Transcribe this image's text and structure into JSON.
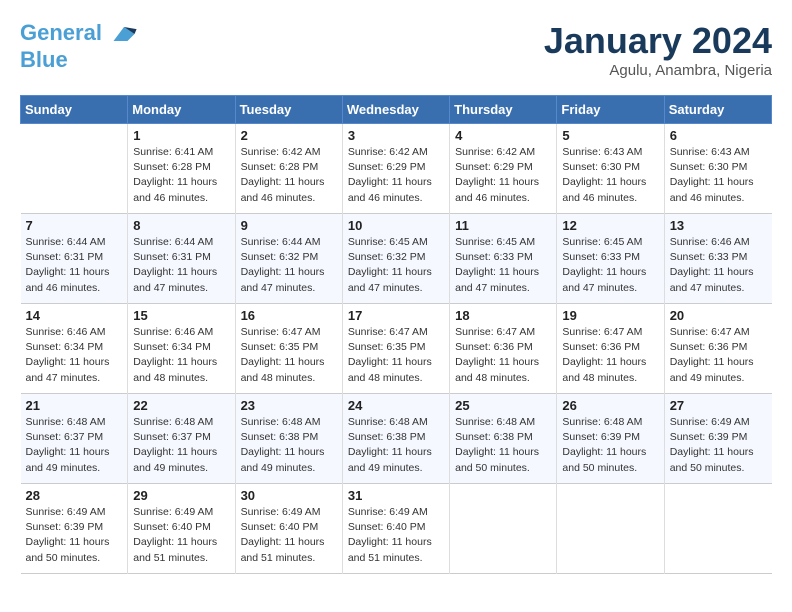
{
  "header": {
    "logo_line1": "General",
    "logo_line2": "Blue",
    "month": "January 2024",
    "location": "Agulu, Anambra, Nigeria"
  },
  "weekdays": [
    "Sunday",
    "Monday",
    "Tuesday",
    "Wednesday",
    "Thursday",
    "Friday",
    "Saturday"
  ],
  "weeks": [
    [
      {
        "day": "",
        "info": ""
      },
      {
        "day": "1",
        "info": "Sunrise: 6:41 AM\nSunset: 6:28 PM\nDaylight: 11 hours\nand 46 minutes."
      },
      {
        "day": "2",
        "info": "Sunrise: 6:42 AM\nSunset: 6:28 PM\nDaylight: 11 hours\nand 46 minutes."
      },
      {
        "day": "3",
        "info": "Sunrise: 6:42 AM\nSunset: 6:29 PM\nDaylight: 11 hours\nand 46 minutes."
      },
      {
        "day": "4",
        "info": "Sunrise: 6:42 AM\nSunset: 6:29 PM\nDaylight: 11 hours\nand 46 minutes."
      },
      {
        "day": "5",
        "info": "Sunrise: 6:43 AM\nSunset: 6:30 PM\nDaylight: 11 hours\nand 46 minutes."
      },
      {
        "day": "6",
        "info": "Sunrise: 6:43 AM\nSunset: 6:30 PM\nDaylight: 11 hours\nand 46 minutes."
      }
    ],
    [
      {
        "day": "7",
        "info": "Sunrise: 6:44 AM\nSunset: 6:31 PM\nDaylight: 11 hours\nand 46 minutes."
      },
      {
        "day": "8",
        "info": "Sunrise: 6:44 AM\nSunset: 6:31 PM\nDaylight: 11 hours\nand 47 minutes."
      },
      {
        "day": "9",
        "info": "Sunrise: 6:44 AM\nSunset: 6:32 PM\nDaylight: 11 hours\nand 47 minutes."
      },
      {
        "day": "10",
        "info": "Sunrise: 6:45 AM\nSunset: 6:32 PM\nDaylight: 11 hours\nand 47 minutes."
      },
      {
        "day": "11",
        "info": "Sunrise: 6:45 AM\nSunset: 6:33 PM\nDaylight: 11 hours\nand 47 minutes."
      },
      {
        "day": "12",
        "info": "Sunrise: 6:45 AM\nSunset: 6:33 PM\nDaylight: 11 hours\nand 47 minutes."
      },
      {
        "day": "13",
        "info": "Sunrise: 6:46 AM\nSunset: 6:33 PM\nDaylight: 11 hours\nand 47 minutes."
      }
    ],
    [
      {
        "day": "14",
        "info": "Sunrise: 6:46 AM\nSunset: 6:34 PM\nDaylight: 11 hours\nand 47 minutes."
      },
      {
        "day": "15",
        "info": "Sunrise: 6:46 AM\nSunset: 6:34 PM\nDaylight: 11 hours\nand 48 minutes."
      },
      {
        "day": "16",
        "info": "Sunrise: 6:47 AM\nSunset: 6:35 PM\nDaylight: 11 hours\nand 48 minutes."
      },
      {
        "day": "17",
        "info": "Sunrise: 6:47 AM\nSunset: 6:35 PM\nDaylight: 11 hours\nand 48 minutes."
      },
      {
        "day": "18",
        "info": "Sunrise: 6:47 AM\nSunset: 6:36 PM\nDaylight: 11 hours\nand 48 minutes."
      },
      {
        "day": "19",
        "info": "Sunrise: 6:47 AM\nSunset: 6:36 PM\nDaylight: 11 hours\nand 48 minutes."
      },
      {
        "day": "20",
        "info": "Sunrise: 6:47 AM\nSunset: 6:36 PM\nDaylight: 11 hours\nand 49 minutes."
      }
    ],
    [
      {
        "day": "21",
        "info": "Sunrise: 6:48 AM\nSunset: 6:37 PM\nDaylight: 11 hours\nand 49 minutes."
      },
      {
        "day": "22",
        "info": "Sunrise: 6:48 AM\nSunset: 6:37 PM\nDaylight: 11 hours\nand 49 minutes."
      },
      {
        "day": "23",
        "info": "Sunrise: 6:48 AM\nSunset: 6:38 PM\nDaylight: 11 hours\nand 49 minutes."
      },
      {
        "day": "24",
        "info": "Sunrise: 6:48 AM\nSunset: 6:38 PM\nDaylight: 11 hours\nand 49 minutes."
      },
      {
        "day": "25",
        "info": "Sunrise: 6:48 AM\nSunset: 6:38 PM\nDaylight: 11 hours\nand 50 minutes."
      },
      {
        "day": "26",
        "info": "Sunrise: 6:48 AM\nSunset: 6:39 PM\nDaylight: 11 hours\nand 50 minutes."
      },
      {
        "day": "27",
        "info": "Sunrise: 6:49 AM\nSunset: 6:39 PM\nDaylight: 11 hours\nand 50 minutes."
      }
    ],
    [
      {
        "day": "28",
        "info": "Sunrise: 6:49 AM\nSunset: 6:39 PM\nDaylight: 11 hours\nand 50 minutes."
      },
      {
        "day": "29",
        "info": "Sunrise: 6:49 AM\nSunset: 6:40 PM\nDaylight: 11 hours\nand 51 minutes."
      },
      {
        "day": "30",
        "info": "Sunrise: 6:49 AM\nSunset: 6:40 PM\nDaylight: 11 hours\nand 51 minutes."
      },
      {
        "day": "31",
        "info": "Sunrise: 6:49 AM\nSunset: 6:40 PM\nDaylight: 11 hours\nand 51 minutes."
      },
      {
        "day": "",
        "info": ""
      },
      {
        "day": "",
        "info": ""
      },
      {
        "day": "",
        "info": ""
      }
    ]
  ]
}
